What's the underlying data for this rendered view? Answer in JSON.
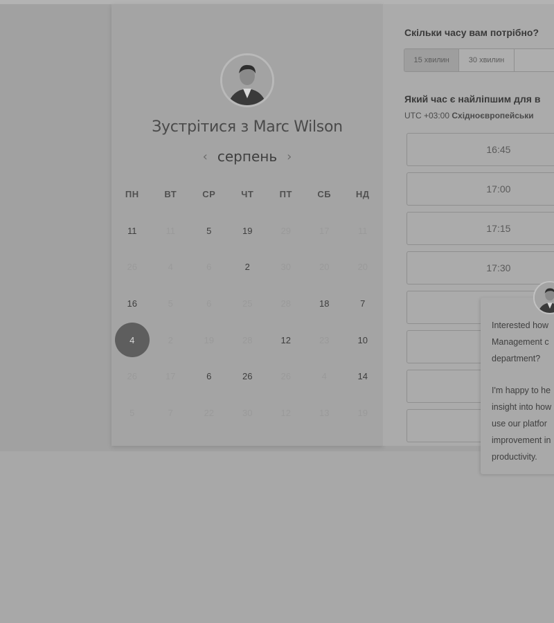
{
  "host": {
    "title": "Зустрітися з Marc Wilson",
    "avatar_icon": "person-portrait-icon"
  },
  "calendar": {
    "month": "серпень",
    "prev_icon": "‹",
    "next_icon": "›",
    "weekdays": [
      "ПН",
      "ВТ",
      "СР",
      "ЧТ",
      "ПТ",
      "СБ",
      "НД"
    ],
    "weeks": [
      [
        {
          "d": "11",
          "a": true
        },
        {
          "d": "11",
          "a": false
        },
        {
          "d": "5",
          "a": true
        },
        {
          "d": "19",
          "a": true
        },
        {
          "d": "29",
          "a": false
        },
        {
          "d": "17",
          "a": false
        },
        {
          "d": "11",
          "a": false
        }
      ],
      [
        {
          "d": "26",
          "a": false
        },
        {
          "d": "4",
          "a": false
        },
        {
          "d": "6",
          "a": false
        },
        {
          "d": "2",
          "a": true
        },
        {
          "d": "30",
          "a": false
        },
        {
          "d": "20",
          "a": false
        },
        {
          "d": "20",
          "a": false
        }
      ],
      [
        {
          "d": "16",
          "a": true
        },
        {
          "d": "5",
          "a": false
        },
        {
          "d": "6",
          "a": false
        },
        {
          "d": "25",
          "a": false
        },
        {
          "d": "28",
          "a": false
        },
        {
          "d": "18",
          "a": true
        },
        {
          "d": "7",
          "a": true
        }
      ],
      [
        {
          "d": "4",
          "a": true,
          "selected": true
        },
        {
          "d": "2",
          "a": false
        },
        {
          "d": "19",
          "a": false
        },
        {
          "d": "28",
          "a": false
        },
        {
          "d": "12",
          "a": true
        },
        {
          "d": "23",
          "a": false
        },
        {
          "d": "10",
          "a": true
        }
      ],
      [
        {
          "d": "26",
          "a": false
        },
        {
          "d": "17",
          "a": false
        },
        {
          "d": "6",
          "a": true
        },
        {
          "d": "26",
          "a": true
        },
        {
          "d": "26",
          "a": false
        },
        {
          "d": "4",
          "a": false
        },
        {
          "d": "14",
          "a": true
        }
      ],
      [
        {
          "d": "5",
          "a": false
        },
        {
          "d": "7",
          "a": false
        },
        {
          "d": "22",
          "a": false
        },
        {
          "d": "30",
          "a": false
        },
        {
          "d": "12",
          "a": false
        },
        {
          "d": "13",
          "a": false
        },
        {
          "d": "19",
          "a": false
        }
      ]
    ]
  },
  "booking": {
    "duration_question": "Скільки часу вам потрібно?",
    "durations": [
      "15 хвилин",
      "30 хвилин",
      ""
    ],
    "time_question": "Який час є найліпшим для в",
    "timezone_prefix": "UTC +03:00 ",
    "timezone_name": "Східноєвропейськи",
    "slots": [
      "16:45",
      "17:00",
      "17:15",
      "17:30",
      "",
      "",
      "",
      ""
    ]
  },
  "chat": {
    "avatar_icon": "person-portrait-icon",
    "lines_1": [
      "Interested how",
      "Management c",
      "department?"
    ],
    "lines_2": [
      "I'm happy to he",
      "insight into how",
      "use our platfor",
      "improvement in",
      "productivity."
    ]
  }
}
